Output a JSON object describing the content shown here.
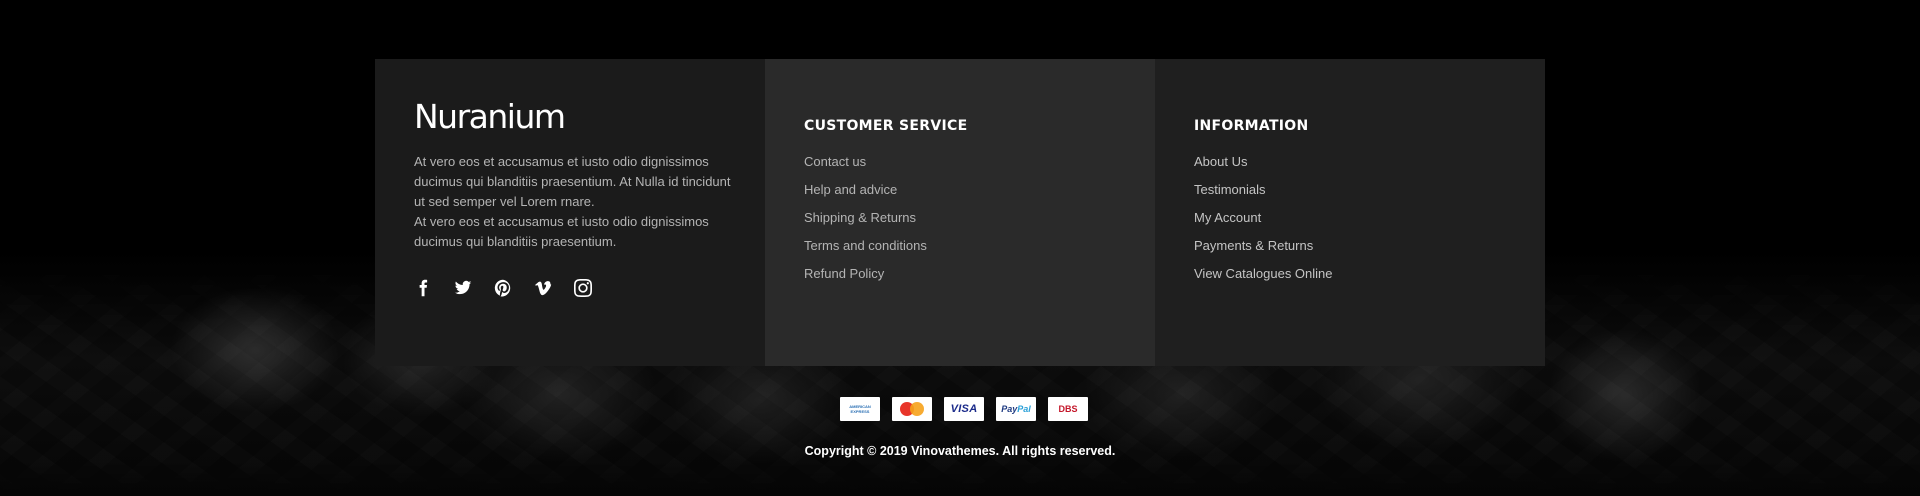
{
  "brand": {
    "logo": "Nuranium",
    "about_lines": [
      "At vero eos et accusamus et iusto odio dignissimos ducimus qui blanditiis praesentium. At Nulla id tincidunt ut sed semper vel Lorem rnare.",
      "At vero eos et accusamus et iusto odio dignissimos ducimus qui blanditiis praesentium."
    ],
    "socials": [
      {
        "icon": "facebook-icon"
      },
      {
        "icon": "twitter-icon"
      },
      {
        "icon": "pinterest-icon"
      },
      {
        "icon": "vimeo-icon"
      },
      {
        "icon": "instagram-icon"
      }
    ]
  },
  "customer_service": {
    "title": "CUSTOMER SERVICE",
    "links": [
      "Contact us",
      "Help and advice",
      "Shipping & Returns",
      "Terms and conditions",
      "Refund Policy"
    ]
  },
  "information": {
    "title": "INFORMATION",
    "links": [
      "About Us",
      "Testimonials",
      "My Account",
      "Payments & Returns",
      "View Catalogues Online"
    ]
  },
  "payments": {
    "amex": "AMERICAN EXPRESS",
    "visa": "VISA",
    "paypal_a": "Pay",
    "paypal_b": "Pal",
    "dbs": "DBS"
  },
  "copyright": "Copyright © 2019 Vinovathemes. All rights reserved.",
  "colors": {
    "background": "#000000",
    "brand_column": "#1b1b1b",
    "service_column": "#2a2a2a",
    "info_column": "#1f1f1f",
    "link_text": "#b4b4b4",
    "heading_text": "#ffffff"
  }
}
